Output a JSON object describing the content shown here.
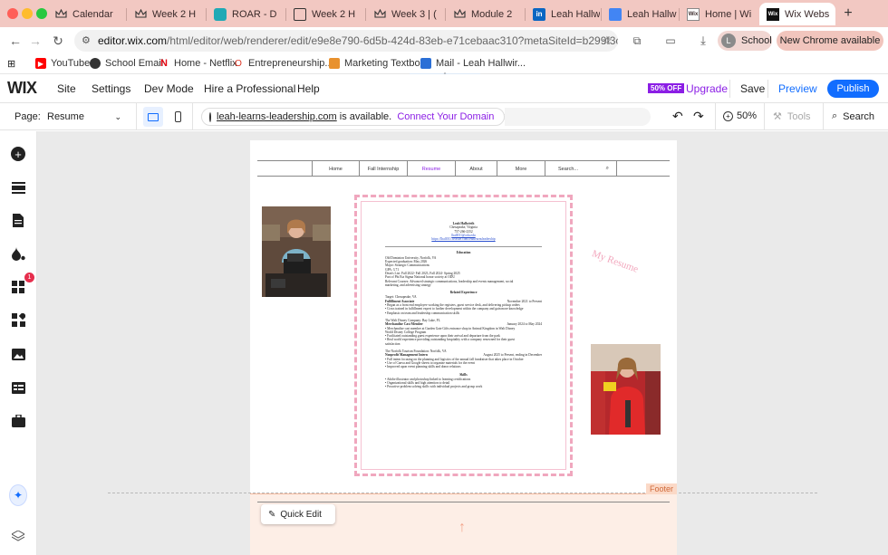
{
  "browser": {
    "tabs": [
      {
        "label": "Calendar",
        "icon": "crown-icon"
      },
      {
        "label": "Week 2 H",
        "icon": "crown-icon"
      },
      {
        "label": "ROAR - D",
        "icon": "roar-icon"
      },
      {
        "label": "Week 2 H",
        "icon": "page-icon"
      },
      {
        "label": "Week 3 | (",
        "icon": "crown-icon"
      },
      {
        "label": "Module 2",
        "icon": "crown-icon"
      },
      {
        "label": "Leah Hallw",
        "icon": "linkedin-icon"
      },
      {
        "label": "Leah Hallw",
        "icon": "docs-icon"
      },
      {
        "label": "Home | Wi",
        "icon": "wix-icon"
      },
      {
        "label": "Wix Webs",
        "icon": "wix-icon"
      }
    ],
    "url_host": "editor.wix.com",
    "url_path": "/html/editor/web/renderer/edit/e9e8e790-6d5b-424d-83eb-e71cebaac310?metaSiteId=b299f3cd-8b1d-...",
    "profile_label": "School",
    "update_label": "New Chrome available",
    "bookmarks": [
      "YouTube",
      "School Email",
      "Home - Netflix",
      "Entrepreneurship...",
      "Marketing Textbook",
      "Mail - Leah Hallwir..."
    ]
  },
  "wix": {
    "logo": "WIX",
    "menu": [
      "Site",
      "Settings",
      "Dev Mode",
      "Hire a Professional",
      "Help"
    ],
    "discount_badge": "50% OFF",
    "upgrade": "Upgrade",
    "save": "Save",
    "preview": "Preview",
    "publish": "Publish",
    "page_label": "Page:",
    "page_value": "Resume",
    "domain": "leah-learns-leadership.com",
    "domain_status": "is available.",
    "connect_domain": "Connect Your Domain",
    "zoom": "50%",
    "tools": "Tools",
    "search": "Search",
    "apps_badge": "1",
    "footer_tag": "Footer",
    "quick_edit": "Quick Edit"
  },
  "site": {
    "menu": [
      "Home",
      "Fall Internship",
      "Resume",
      "About",
      "More",
      "Search..."
    ],
    "my_resume_text": "My Resume"
  },
  "resume": {
    "name": "Leah Hallwirth",
    "location": "Chesapeake, Virginia",
    "phone": "757-266-2352",
    "email": "lhall011@odu.edu",
    "url": "https://lhall011.wixsite.com/leahlearnsleadership",
    "education_title": "Education",
    "edu_lines": [
      "Old Dominion University, Norfolk, VA",
      "Expected graduation: May 2026",
      "Major: Strategic Communications",
      "GPA: 3.71",
      "Dean's List: Fall 2022- Fall 2023, Fall 2024- Spring 2025",
      "Part of Phi Eta Sigma National honor society at ODU",
      "Relevant Courses: Advanced strategic communications, leadership and events management, social",
      "marketing, and advertising strategy"
    ],
    "experience_title": "Related Experience",
    "exp1_company": "Target: Chesapeake, VA",
    "exp1_role": "Fulfillment Associate",
    "exp1_dates": "November 2021 to Present",
    "exp1_bullets": [
      "• Began as a front end employee working the registers, guest service desk, and delivering pickup orders",
      "• Cross trained in fulfillment expert to further development within the company and gain more knowledge",
      "• Emphasis on team and leadership communication skills"
    ],
    "exp2_company": "The Walt Disney Company: Bay Lake, FL",
    "exp2_role": "Merchandise Cast Member",
    "exp2_dates": "January 2024 to May 2024",
    "exp2_bullets": [
      "• Merchandise cast member at Garden Gate Gifts entrance shop in Animal Kingdom in Walt Disney",
      "World Disney College Program",
      "• Facilitated outstanding guest experience upon their arrival and departure from the park",
      "• Real world experience providing outstanding hospitality with a company renowned for their guest",
      "satisfaction"
    ],
    "exp3_company": "The Norfolk Tourism Foundation: Norfolk, VA",
    "exp3_role": "Nonprofit Management Intern",
    "exp3_dates": "August 2025 to Present, ending in December",
    "exp3_bullets": [
      "• Full intern focusing on the planning and logistics of the annual fall fundraiser that takes place in October",
      "• Use of Canva and Google sheets to organize materials for the event",
      "• Improved upon event planning skills and donor relations"
    ],
    "skills_title": "Skills",
    "skills": [
      "• Adobe illustrator and photoshop linked to learning certifications",
      "• Organizational skills and high attention to detail",
      "• Proactive problem solving skills with individual projects and group work"
    ]
  },
  "colors": {
    "tab_strip": "#f2c8c2",
    "wix_blue": "#116dff",
    "upgrade_purple": "#8b1ee5",
    "resume_border": "#f0a7be",
    "footer_bg": "#fdeee6"
  }
}
